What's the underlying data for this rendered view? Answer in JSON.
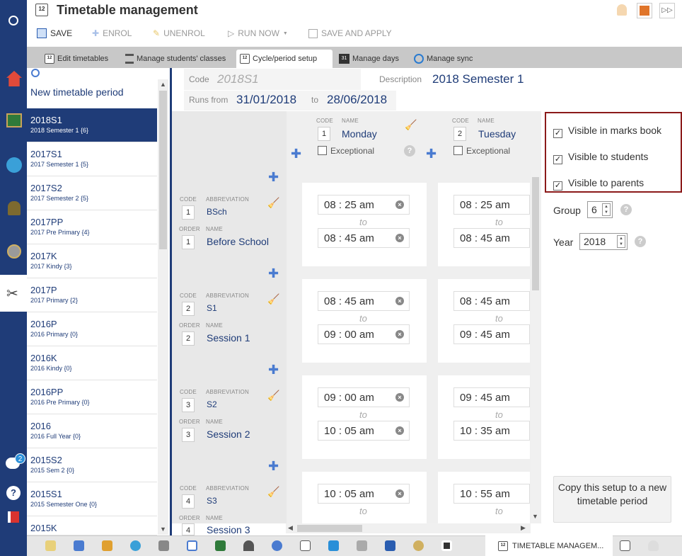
{
  "app": {
    "title": "Timetable management"
  },
  "toolbar": {
    "save": "SAVE",
    "enrol": "ENROL",
    "unenrol": "UNENROL",
    "run_now": "RUN NOW",
    "save_apply": "SAVE AND APPLY"
  },
  "tabs": [
    "Edit timetables",
    "Manage students' classes",
    "Cycle/period setup",
    "Manage days",
    "Manage sync"
  ],
  "list": {
    "new_label": "New timetable period",
    "items": [
      {
        "code": "2018S1",
        "desc": "2018 Semester 1 {6}"
      },
      {
        "code": "2017S1",
        "desc": "2017 Semester 1 {5}"
      },
      {
        "code": "2017S2",
        "desc": "2017 Semester 2 {5}"
      },
      {
        "code": "2017PP",
        "desc": "2017 Pre Primary {4}"
      },
      {
        "code": "2017K",
        "desc": "2017 Kindy {3}"
      },
      {
        "code": "2017P",
        "desc": "2017 Primary {2}"
      },
      {
        "code": "2016P",
        "desc": "2016 Primary {0}"
      },
      {
        "code": "2016K",
        "desc": "2016 Kindy {0}"
      },
      {
        "code": "2016PP",
        "desc": "2016 Pre Primary {0}"
      },
      {
        "code": "2016",
        "desc": "2016 Full Year {0}"
      },
      {
        "code": "2015S2",
        "desc": "2015 Sem 2 {0}"
      },
      {
        "code": "2015S1",
        "desc": "2015 Semester One {0}"
      },
      {
        "code": "2015K",
        "desc": ""
      }
    ]
  },
  "form": {
    "code_label": "Code",
    "code_value": "2018S1",
    "desc_label": "Description",
    "desc_value": "2018 Semester 1",
    "runs_label": "Runs from",
    "from": "31/01/2018",
    "to_label": "to",
    "to": "28/06/2018"
  },
  "grid": {
    "code_caption": "CODE",
    "name_caption": "NAME",
    "abbr_caption": "ABBREVIATION",
    "order_caption": "ORDER",
    "exceptional": "Exceptional",
    "to_text": "to",
    "days": [
      {
        "code": "1",
        "name": "Monday"
      },
      {
        "code": "2",
        "name": "Tuesday"
      }
    ],
    "periods": [
      {
        "code": "1",
        "abbr": "BSch",
        "order": "1",
        "name": "Before School",
        "mon_start": "08 : 25  am",
        "mon_end": "08 : 45  am",
        "tue_start": "08 : 25  am",
        "tue_end": "08 : 45  am"
      },
      {
        "code": "2",
        "abbr": "S1",
        "order": "2",
        "name": "Session 1",
        "mon_start": "08 : 45  am",
        "mon_end": "09 : 00  am",
        "tue_start": "08 : 45  am",
        "tue_end": "09 : 45  am"
      },
      {
        "code": "3",
        "abbr": "S2",
        "order": "3",
        "name": "Session 2",
        "mon_start": "09 : 00  am",
        "mon_end": "10 : 05  am",
        "tue_start": "09 : 45  am",
        "tue_end": "10 : 35  am"
      },
      {
        "code": "4",
        "abbr": "S3",
        "order": "4",
        "name": "Session 3",
        "mon_start": "10 : 05  am",
        "mon_end": "",
        "tue_start": "10 : 55  am",
        "tue_end": ""
      }
    ]
  },
  "visibility": {
    "marks_book": "Visible in marks book",
    "students": "Visible to students",
    "parents": "Visible to parents"
  },
  "group": {
    "label": "Group",
    "value": "6"
  },
  "year": {
    "label": "Year",
    "value": "2018"
  },
  "copy_button": "Copy this setup to a new timetable period",
  "bottom_tab": "TIMETABLE MANAGEM...",
  "badge_count": "2",
  "calendar_glyph": "12"
}
